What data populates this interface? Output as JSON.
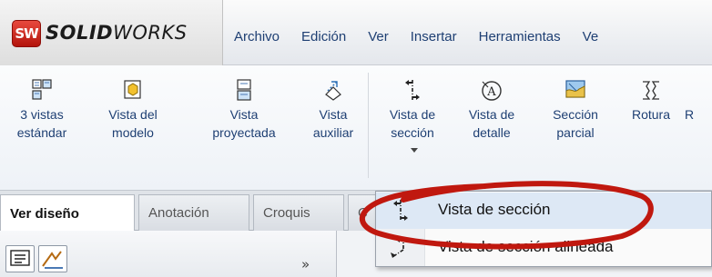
{
  "app": {
    "logo_badge": "SW",
    "logo_bold": "SOLID",
    "logo_rest": "WORKS",
    "brand_color": "#c8201a"
  },
  "menu": {
    "items": [
      "Archivo",
      "Edición",
      "Ver",
      "Insertar",
      "Herramientas",
      "Ve"
    ]
  },
  "toolbar": {
    "tools": [
      {
        "label": "3 vistas\nestándar",
        "icon": "three-views-icon"
      },
      {
        "label": "Vista del\nmodelo",
        "icon": "model-view-icon"
      },
      {
        "label": "Vista\nproyectada",
        "icon": "projected-view-icon"
      },
      {
        "label": "Vista\nauxiliar",
        "icon": "auxiliary-view-icon"
      },
      {
        "label": "Vista de\nsección",
        "icon": "section-view-icon"
      },
      {
        "label": "Vista de\ndetalle",
        "icon": "detail-view-icon"
      },
      {
        "label": "Sección\nparcial",
        "icon": "broken-out-section-icon"
      },
      {
        "label": "Rotura",
        "icon": "break-icon"
      },
      {
        "label": "R",
        "icon": "crop-icon"
      }
    ]
  },
  "tabs": {
    "items": [
      "Ver diseño",
      "Anotación",
      "Croquis",
      "C"
    ],
    "active": "Ver diseño"
  },
  "panel": {
    "chevron": "»"
  },
  "flyout": {
    "items": [
      {
        "label": "Vista de sección",
        "icon": "section-view-icon"
      },
      {
        "label": "Vista de sección alineada",
        "icon": "aligned-section-view-icon"
      }
    ],
    "annotation_color": "#c0180f"
  }
}
